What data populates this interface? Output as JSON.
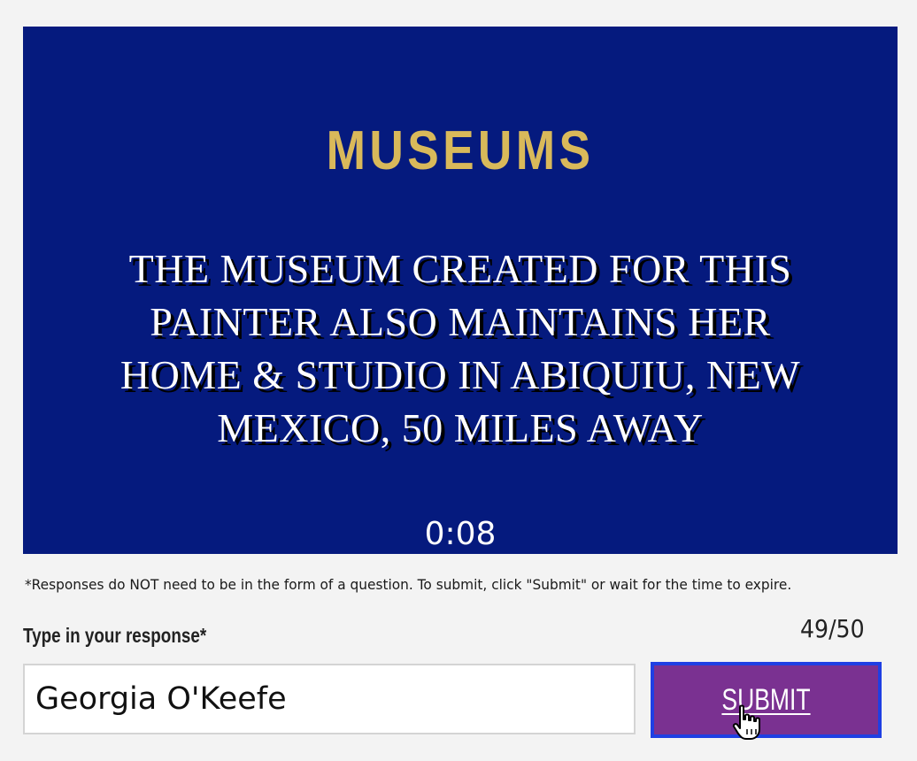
{
  "clue": {
    "category": "MUSEUMS",
    "text": "THE MUSEUM CREATED FOR THIS PAINTER ALSO MAINTAINS HER HOME & STUDIO IN ABIQUIU, NEW MEXICO, 50 MILES AWAY",
    "timer": "0:08"
  },
  "disclaimer": "*Responses do NOT need to be in the form of a question. To submit, click \"Submit\" or wait for the time to expire.",
  "response": {
    "label": "Type in your response*",
    "value": "Georgia O'Keefe",
    "count": "49/50"
  },
  "submit": {
    "label": "SUBMIT"
  },
  "colors": {
    "board_background": "#051a7e",
    "category_gold": "#d9b95a",
    "submit_purple": "#7a3191",
    "submit_focus_border": "#1f3fe3"
  },
  "icons": {
    "cursor": "hand-pointer-icon"
  }
}
